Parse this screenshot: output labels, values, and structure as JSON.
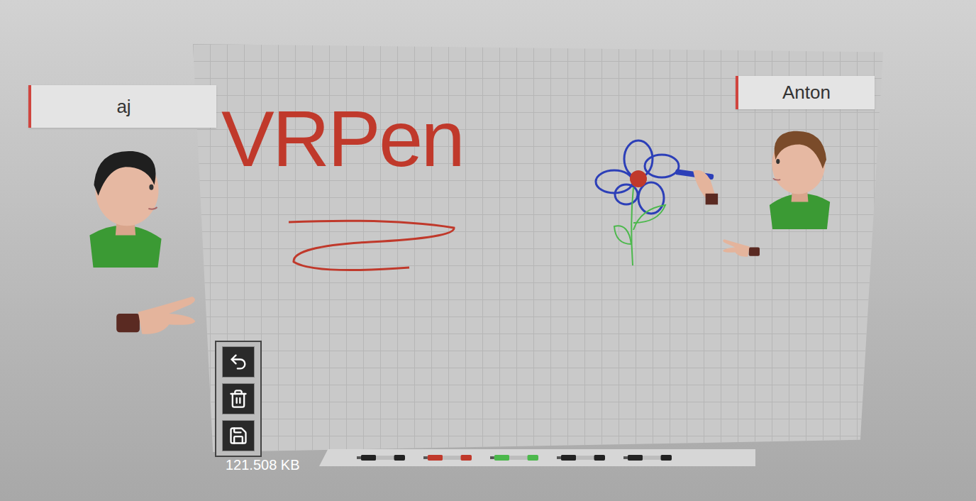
{
  "users": [
    {
      "name": "aj"
    },
    {
      "name": "Anton"
    }
  ],
  "board": {
    "drawing_text": "VRPen"
  },
  "file_size": "121.508 KB",
  "markers": [
    {
      "color": "#222222"
    },
    {
      "color": "#c0392b"
    },
    {
      "color": "#4cb84c"
    },
    {
      "color": "#222222"
    },
    {
      "color": "#222222"
    }
  ]
}
